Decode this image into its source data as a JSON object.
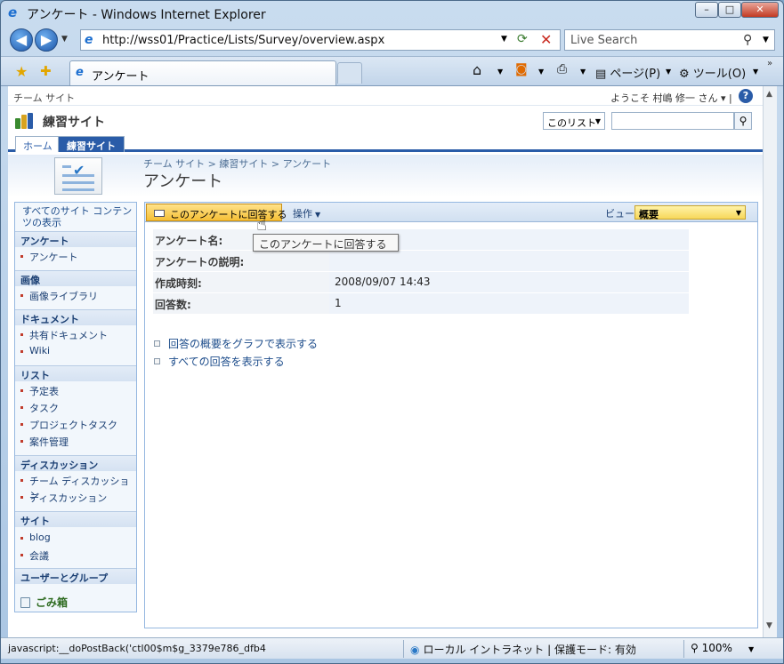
{
  "window": {
    "title": "アンケート - Windows Internet Explorer",
    "min_label": "–",
    "max_label": "□",
    "close_label": "✕"
  },
  "addressbar": {
    "url": "http://wss01/Practice/Lists/Survey/overview.aspx",
    "search_placeholder": "Live Search"
  },
  "tabs": {
    "active_label": "アンケート"
  },
  "ie_toolbar": {
    "page_label": "ページ(P)",
    "tools_label": "ツール(O)"
  },
  "sp_header": {
    "site_breadcrumb_top": "チーム サイト",
    "welcome": "ようこそ 村嶋 修一 さん ▾  |",
    "help": "?",
    "site_title": "練習サイト",
    "scope_label": "このリスト",
    "search_value": ""
  },
  "topnav": {
    "home": "ホーム",
    "current": "練習サイト"
  },
  "titlearea": {
    "breadcrumb": "チーム サイト > 練習サイト > アンケート",
    "page_title": "アンケート"
  },
  "leftnav": {
    "view_all": "すべてのサイト コンテンツの表示",
    "sections": [
      {
        "title": "アンケート",
        "items": [
          "アンケート"
        ]
      },
      {
        "title": "画像",
        "items": [
          "画像ライブラリ"
        ]
      },
      {
        "title": "ドキュメント",
        "items": [
          "共有ドキュメント",
          "Wiki"
        ]
      },
      {
        "title": "リスト",
        "items": [
          "予定表",
          "タスク",
          "プロジェクトタスク",
          "案件管理"
        ]
      },
      {
        "title": "ディスカッション",
        "items": [
          "チーム ディスカッション",
          "ディスカッション"
        ]
      },
      {
        "title": "サイト",
        "items": [
          "blog",
          "会議"
        ]
      },
      {
        "title": "ユーザーとグループ",
        "items": []
      }
    ],
    "recycle_bin": "ごみ箱"
  },
  "main_toolbar": {
    "respond_label": "このアンケートに回答する",
    "actions_label": "操作",
    "view_label": "ビュー:",
    "view_value": "概要"
  },
  "properties": [
    {
      "label": "アンケート名:",
      "value": ""
    },
    {
      "label": "アンケートの説明:",
      "value": ""
    },
    {
      "label": "作成時刻:",
      "value": "2008/09/07 14:43"
    },
    {
      "label": "回答数:",
      "value": "1"
    }
  ],
  "links": {
    "graph_summary": "回答の概要をグラフで表示する",
    "all_responses": "すべての回答を表示する"
  },
  "tooltip": "このアンケートに回答する",
  "statusbar": {
    "text": "javascript:__doPostBack('ctl00$m$g_3379e786_dfb4",
    "zone": "ローカル イントラネット | 保護モード: 有効",
    "zoom": "100%"
  },
  "colors": {
    "accent": "#2a5ca8",
    "respond_button": "#f5bf36",
    "link": "#1b4b8a"
  }
}
